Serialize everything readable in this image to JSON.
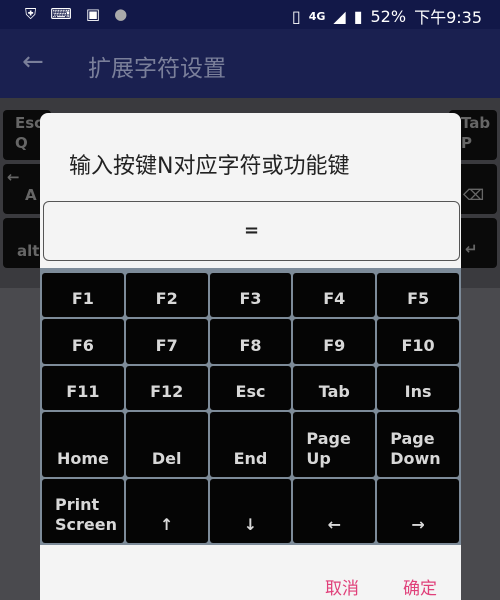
{
  "status_bar": {
    "icons_left": [
      "shield-check-icon",
      "keyboard-icon",
      "image-icon",
      "circle-icon"
    ],
    "battery": "52%",
    "time": "下午9:35",
    "network": "4G"
  },
  "app_bar": {
    "title": "扩展字符设置"
  },
  "background_keys": {
    "top_left": "Esc",
    "q": "Q",
    "top_right": "Tab",
    "p": "P",
    "a": "A",
    "alt": "alt",
    "arrow": "←"
  },
  "dialog": {
    "title": "输入按键N对应字符或功能键",
    "input_value": "=",
    "keys": [
      "F1",
      "F2",
      "F3",
      "F4",
      "F5",
      "F6",
      "F7",
      "F8",
      "F9",
      "F10",
      "F11",
      "F12",
      "Esc",
      "Tab",
      "Ins",
      "Home",
      "Del",
      "End",
      "Page Up",
      "Page Down",
      "Print Screen",
      "↑",
      "↓",
      "←",
      "→"
    ],
    "cancel": "取消",
    "ok": "确定"
  },
  "colors": {
    "accent": "#e0407a",
    "status_bar": "#121848",
    "app_bar": "#1a2050"
  }
}
